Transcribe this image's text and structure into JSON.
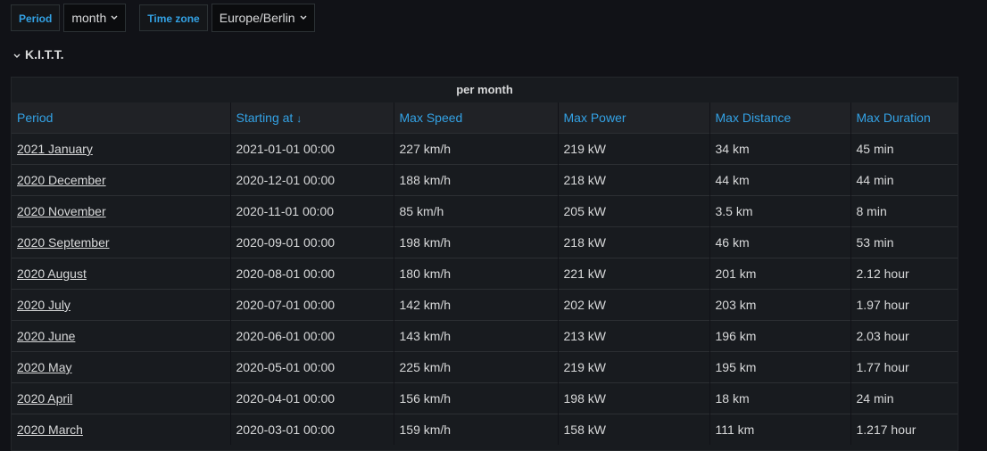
{
  "variables": {
    "period_label": "Period",
    "period_value": "month",
    "timezone_label": "Time zone",
    "timezone_value": "Europe/Berlin"
  },
  "row": {
    "title": "K.I.T.T."
  },
  "panel": {
    "title": "per month",
    "columns": [
      "Period",
      "Starting at",
      "Max Speed",
      "Max Power",
      "Max Distance",
      "Max Duration"
    ],
    "sort_indicator": "↓",
    "rows": [
      [
        "2021 January",
        "2021-01-01 00:00",
        "227 km/h",
        "219 kW",
        "34 km",
        "45 min"
      ],
      [
        "2020 December",
        "2020-12-01 00:00",
        "188 km/h",
        "218 kW",
        "44 km",
        "44 min"
      ],
      [
        "2020 November",
        "2020-11-01 00:00",
        "85 km/h",
        "205 kW",
        "3.5 km",
        "8 min"
      ],
      [
        "2020 September",
        "2020-09-01 00:00",
        "198 km/h",
        "218 kW",
        "46 km",
        "53 min"
      ],
      [
        "2020 August",
        "2020-08-01 00:00",
        "180 km/h",
        "221 kW",
        "201 km",
        "2.12 hour"
      ],
      [
        "2020 July",
        "2020-07-01 00:00",
        "142 km/h",
        "202 kW",
        "203 km",
        "1.97 hour"
      ],
      [
        "2020 June",
        "2020-06-01 00:00",
        "143 km/h",
        "213 kW",
        "196 km",
        "2.03 hour"
      ],
      [
        "2020 May",
        "2020-05-01 00:00",
        "225 km/h",
        "219 kW",
        "195 km",
        "1.77 hour"
      ],
      [
        "2020 April",
        "2020-04-01 00:00",
        "156 km/h",
        "198 kW",
        "18 km",
        "24 min"
      ],
      [
        "2020 March",
        "2020-03-01 00:00",
        "159 km/h",
        "158 kW",
        "111 km",
        "1.217 hour"
      ]
    ]
  }
}
